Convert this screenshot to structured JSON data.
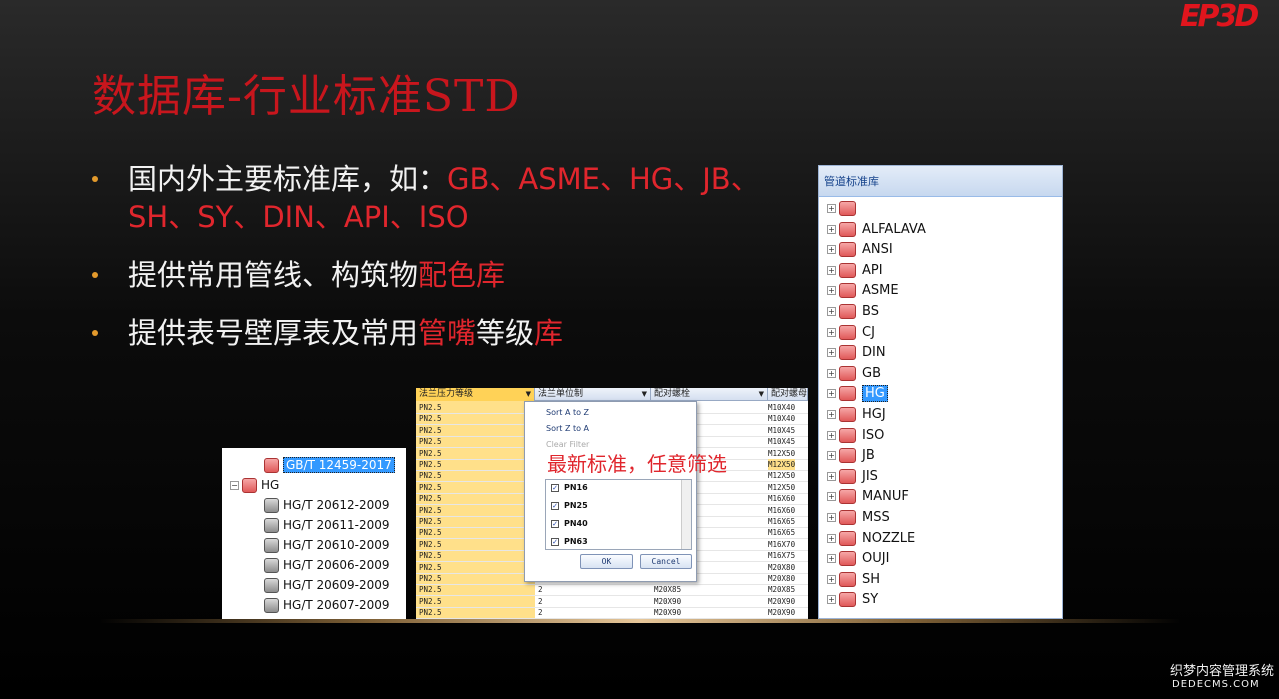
{
  "logo": "EP3D",
  "title": "数据库-行业标准STD",
  "bullets": [
    {
      "white": "国内外主要标准库，如：",
      "red": "GB、ASME、HG、JB、SH、SY、DIN、API、ISO",
      "white2": ""
    },
    {
      "white": "提供常用管线、构筑物",
      "red": "配色库",
      "white2": ""
    },
    {
      "white": "提供表号壁厚表及常用",
      "red": "管嘴",
      "white2": "等级",
      "red2": "库"
    }
  ],
  "left_tree": {
    "selected": "GB/T 12459-2017",
    "group": "HG",
    "items": [
      "HG/T 20612-2009",
      "HG/T 20611-2009",
      "HG/T 20610-2009",
      "HG/T 20606-2009",
      "HG/T 20609-2009",
      "HG/T 20607-2009"
    ]
  },
  "grid": {
    "headers": [
      "法兰压力等级",
      "法兰单位制",
      "配对螺栓",
      "配对螺母"
    ],
    "col0": "PN2.5",
    "col3": [
      "M10X40",
      "M10X40",
      "M10X45",
      "M10X45",
      "M12X50",
      "M12X50",
      "M12X50",
      "M12X50",
      "M16X60",
      "M16X60",
      "M16X65",
      "M16X65",
      "M16X70",
      "M16X75",
      "M20X80",
      "M20X80",
      "M20X85",
      "M20X90",
      "M20X90"
    ],
    "bottom_rows": [
      {
        "c1": "2",
        "c2": "M20X85",
        "c3": "M20X85"
      },
      {
        "c1": "2",
        "c2": "M20X90",
        "c3": "M20X90"
      },
      {
        "c1": "2",
        "c2": "M20X90",
        "c3": "M20X90"
      }
    ]
  },
  "popup": {
    "sort_az": "Sort A to Z",
    "sort_za": "Sort Z to A",
    "clear": "Clear Filter",
    "options": [
      "PN16",
      "PN25",
      "PN40",
      "PN63"
    ],
    "ok": "OK",
    "cancel": "Cancel"
  },
  "overlay_text": "最新标准，任意筛选",
  "right_panel": {
    "title": "管道标准库",
    "items": [
      "",
      "ALFALAVA",
      "ANSI",
      "API",
      "ASME",
      "BS",
      "CJ",
      "DIN",
      "GB",
      "HG",
      "HGJ",
      "ISO",
      "JB",
      "JIS",
      "MANUF",
      "MSS",
      "NOZZLE",
      "OUJI",
      "SH",
      "SY"
    ],
    "selected": "HG"
  },
  "watermark": {
    "line1": "织梦内容管理系统",
    "line2": "DEDECMS.COM"
  }
}
